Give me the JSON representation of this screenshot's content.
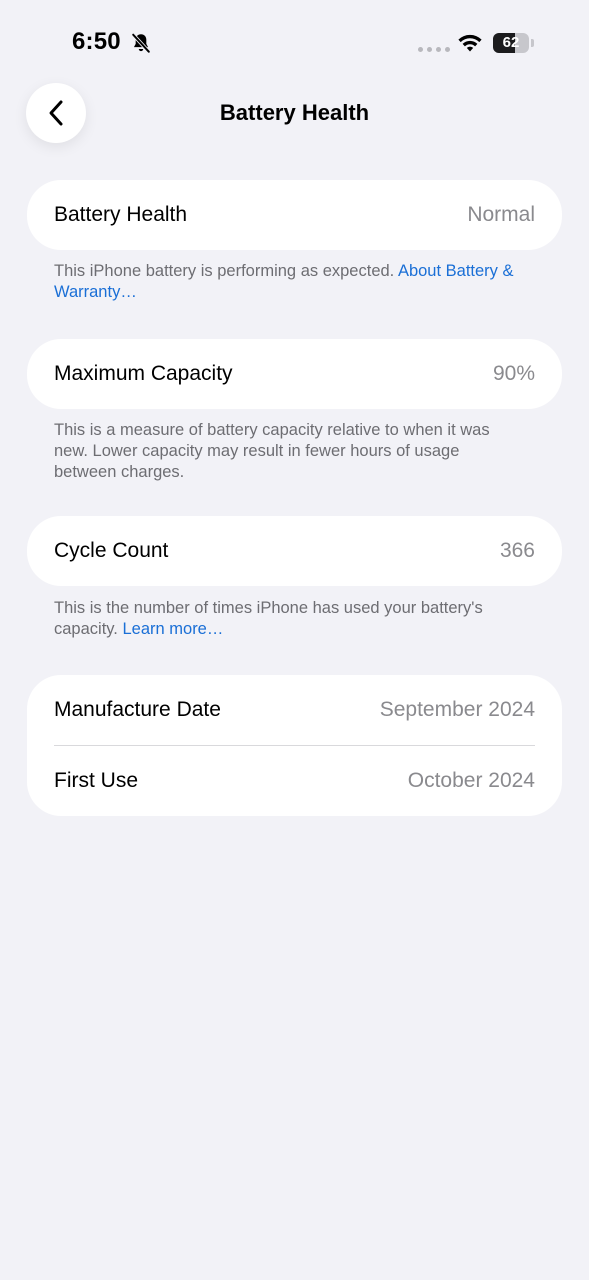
{
  "status_bar": {
    "time": "6:50",
    "battery_level": "62",
    "battery_fraction": 0.62
  },
  "nav": {
    "title": "Battery Health"
  },
  "battery_health": {
    "label": "Battery Health",
    "value": "Normal",
    "note": "This iPhone battery is performing as expected.",
    "link": "About Battery & Warranty…"
  },
  "maximum_capacity": {
    "label": "Maximum Capacity",
    "value": "90%",
    "note": "This is a measure of battery capacity relative to when it was new. Lower capacity may result in fewer hours of usage between charges."
  },
  "cycle_count": {
    "label": "Cycle Count",
    "value": "366",
    "note": "This is the number of times iPhone has used your battery's capacity.",
    "link": "Learn more…"
  },
  "dates": {
    "manufacture_label": "Manufacture Date",
    "manufacture_value": "September 2024",
    "first_use_label": "First Use",
    "first_use_value": "October 2024"
  },
  "colors": {
    "background": "#f2f2f7",
    "link": "#1a6fd6",
    "secondary_text": "#8a8a8e"
  }
}
